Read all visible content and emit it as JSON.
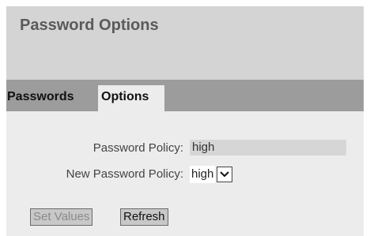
{
  "header": {
    "title": "Password Options"
  },
  "tabs": [
    {
      "label": "Passwords",
      "active": false
    },
    {
      "label": "Options",
      "active": true
    }
  ],
  "form": {
    "policy_label": "Password Policy:",
    "policy_value": "high",
    "new_policy_label": "New Password Policy:",
    "new_policy_value": "high"
  },
  "buttons": {
    "set_values": "Set Values",
    "refresh": "Refresh"
  },
  "colors": {
    "header_bg": "#d4d4d4",
    "tabbar_bg": "#9c9c9c",
    "active_tab_bg": "#ececec",
    "content_bg": "#ececec"
  }
}
